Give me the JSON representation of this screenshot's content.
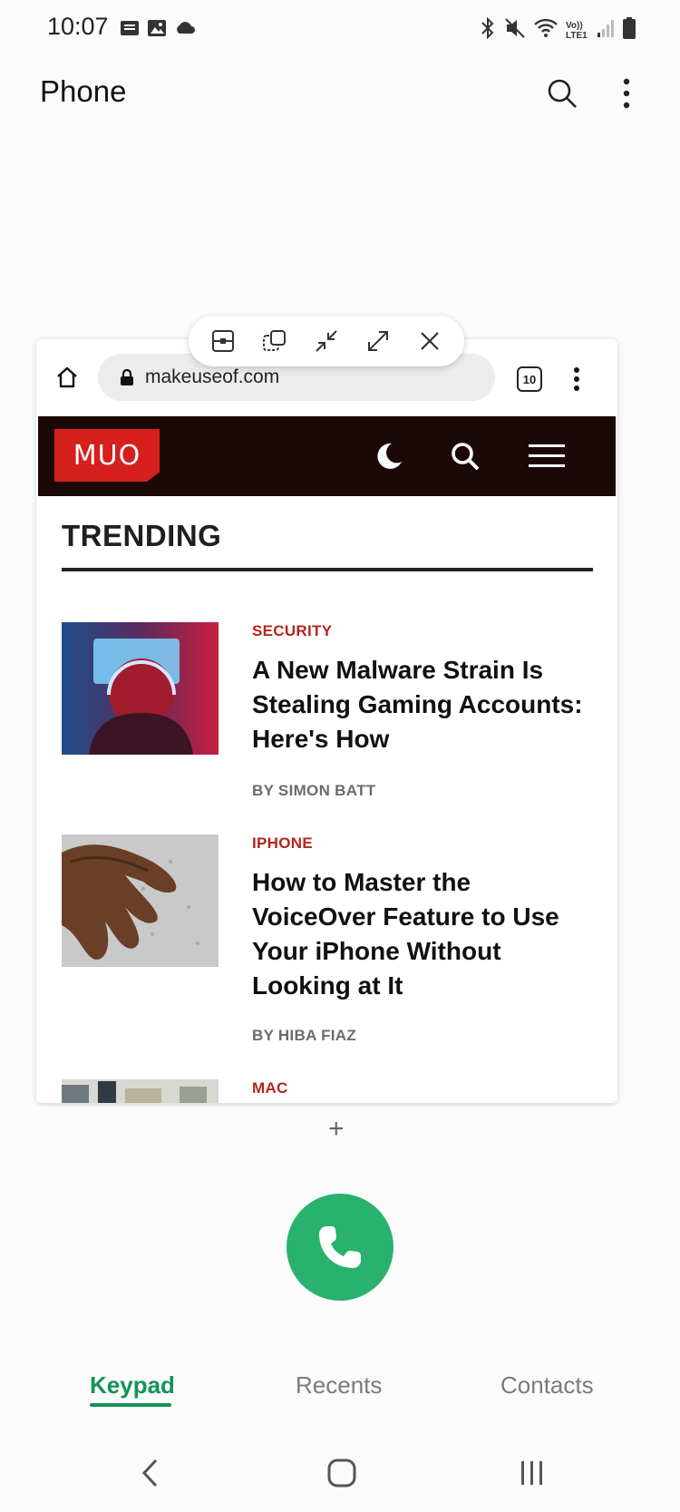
{
  "status_bar": {
    "time": "10:07",
    "left_icons": [
      "message-icon",
      "image-icon",
      "cloud-icon"
    ],
    "right_icons": [
      "bluetooth-icon",
      "mute-icon",
      "wifi-icon",
      "volte-icon",
      "signal-icon",
      "battery-icon"
    ],
    "volte_label": "Vo)) LTE1"
  },
  "app_bar": {
    "title": "Phone",
    "icons": [
      "search-icon",
      "more-vert-icon"
    ]
  },
  "popup_toolbar": {
    "buttons": [
      "split-screen-icon",
      "switch-window-icon",
      "minimize-icon",
      "maximize-icon",
      "close-icon"
    ]
  },
  "browser": {
    "url": "makeuseof.com",
    "tab_count": "10"
  },
  "site": {
    "logo": "MUO",
    "section_title": "TRENDING",
    "articles": [
      {
        "category": "SECURITY",
        "title": "A New Malware Strain Is Stealing Gaming Accounts: Here's How",
        "author": "BY SIMON BATT"
      },
      {
        "category": "IPHONE",
        "title": "How to Master the VoiceOver Feature to Use Your iPhone Without Looking at It",
        "author": "BY HIBA FIAZ"
      },
      {
        "category": "MAC",
        "title": "",
        "author": ""
      }
    ]
  },
  "add_label": "+",
  "bottom_tabs": [
    {
      "label": "Keypad",
      "active": true
    },
    {
      "label": "Recents",
      "active": false
    },
    {
      "label": "Contacts",
      "active": false
    }
  ],
  "colors": {
    "accent_green": "#28b26e",
    "tab_active": "#159356",
    "muo_red": "#d5201d",
    "category_red": "#b3261e",
    "site_header": "#1c0808"
  },
  "nav_bar": [
    "back-icon",
    "home-icon",
    "recents-icon"
  ]
}
